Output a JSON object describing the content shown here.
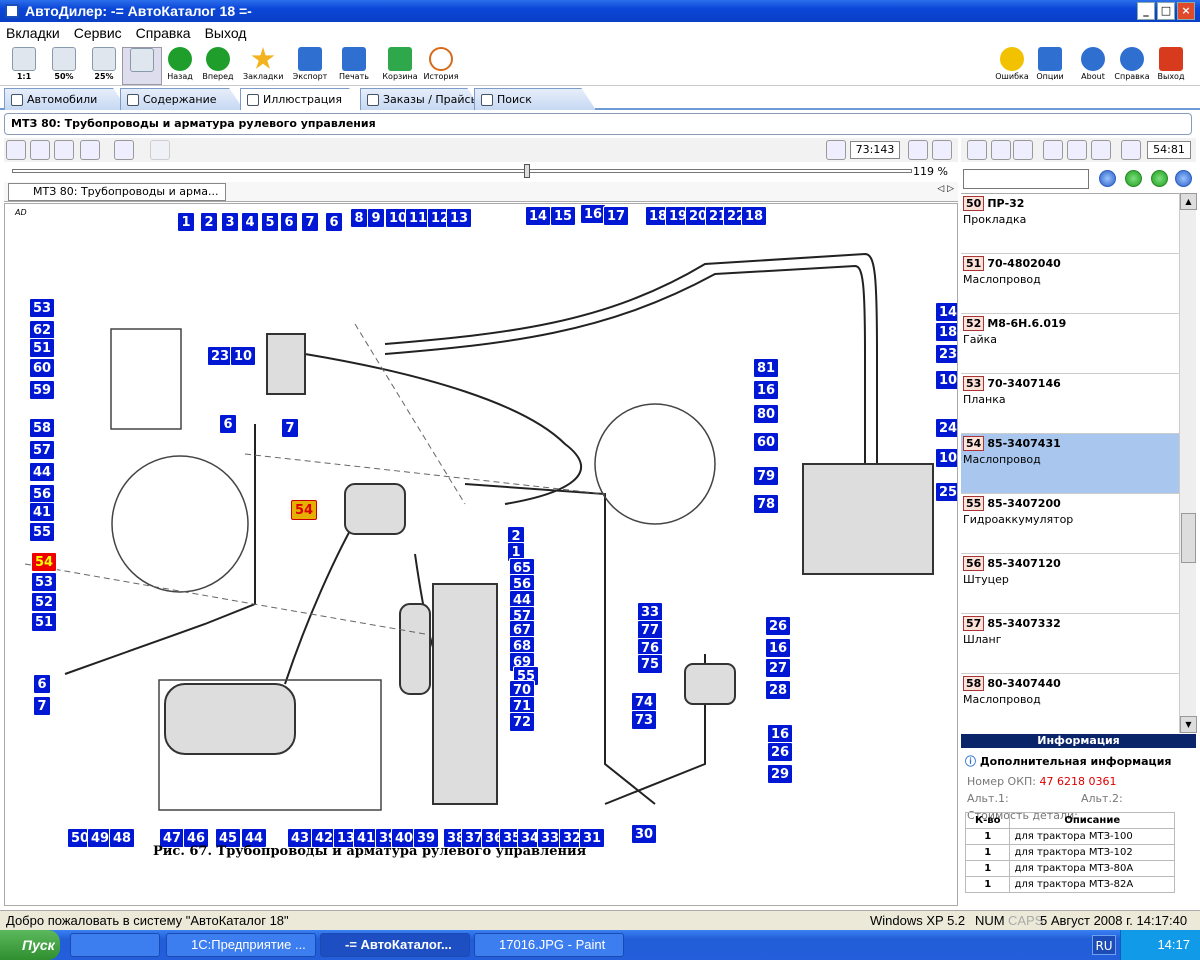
{
  "window": {
    "title": "АвтоДилер: -= АвтоКаталог 18 =-"
  },
  "menu": [
    "Вкладки",
    "Сервис",
    "Справка",
    "Выход"
  ],
  "toolbar": {
    "zoom": [
      "1:1",
      "50%",
      "25%",
      ""
    ],
    "nav": [
      {
        "label": "Назад",
        "color": "#1f9e2c"
      },
      {
        "label": "Вперед",
        "color": "#1f9e2c"
      },
      {
        "label": "Закладки",
        "color": "#f2b31e"
      },
      {
        "label": "Экспорт",
        "color": "#2e6fd0"
      },
      {
        "label": "Печать",
        "color": "#2e6fd0"
      },
      {
        "label": "Корзина",
        "color": "#2ea84a"
      },
      {
        "label": "История",
        "color": "#d66b1a"
      }
    ],
    "right": [
      {
        "label": "Ошибка",
        "color": "#f2c200"
      },
      {
        "label": "Опции",
        "color": "#2e6fd0"
      },
      {
        "label": "About",
        "color": "#2e6fd0"
      },
      {
        "label": "Справка",
        "color": "#2e6fd0"
      },
      {
        "label": "Выход",
        "color": "#d83a1e"
      }
    ]
  },
  "tabs": [
    "Автомобили",
    "Содержание",
    "Иллюстрация",
    "Заказы / Прайсы",
    "Поиск"
  ],
  "doc_title": "МТЗ 80: Трубопроводы и арматура рулевого управления",
  "page_counter": "73:143",
  "zoom_value": "119 %",
  "doc_tab": "МТЗ 80: Трубопроводы и арма...",
  "illustration": {
    "corner_mark": "AD",
    "caption": "Рис. 67. Трубопроводы и арматура рулевого управления",
    "callouts": [
      "1",
      "2",
      "3",
      "4",
      "5",
      "6",
      "7",
      "6",
      "8",
      "9",
      "10",
      "11",
      "12",
      "13",
      "14",
      "15",
      "16",
      "17",
      "18",
      "19",
      "20",
      "21",
      "22",
      "18",
      "53",
      "62",
      "51",
      "60",
      "59",
      "23",
      "10",
      "14",
      "18",
      "23",
      "10",
      "58",
      "6",
      "7",
      "81",
      "16",
      "80",
      "60",
      "57",
      "44",
      "56",
      "41",
      "55",
      "24",
      "10",
      "54",
      "79",
      "78",
      "25",
      "2",
      "1",
      "65",
      "56",
      "44",
      "57",
      "54",
      "53",
      "52",
      "51",
      "67",
      "68",
      "69",
      "33",
      "77",
      "76",
      "75",
      "26",
      "16",
      "27",
      "28",
      "6",
      "7",
      "55",
      "70",
      "71",
      "72",
      "74",
      "73",
      "16",
      "26",
      "29",
      "50",
      "49",
      "48",
      "47",
      "46",
      "45",
      "44",
      "43",
      "42",
      "13",
      "41",
      "39",
      "40",
      "39",
      "38",
      "37",
      "36",
      "35",
      "34",
      "33",
      "32",
      "31",
      "30"
    ]
  },
  "right_panel": {
    "page_counter": "54:81",
    "search": {
      "value": "",
      "placeholder": ""
    },
    "parts": [
      {
        "num": "50",
        "code": "ПР-32",
        "name": "Прокладка"
      },
      {
        "num": "51",
        "code": "70-4802040",
        "name": "Маслопровод"
      },
      {
        "num": "52",
        "code": "М8-6Н.6.019",
        "name": "Гайка"
      },
      {
        "num": "53",
        "code": "70-3407146",
        "name": "Планка"
      },
      {
        "num": "54",
        "code": "85-3407431",
        "name": "Маслопровод"
      },
      {
        "num": "55",
        "code": "85-3407200",
        "name": "Гидроаккумулятор"
      },
      {
        "num": "56",
        "code": "85-3407120",
        "name": "Штуцер"
      },
      {
        "num": "57",
        "code": "85-3407332",
        "name": "Шланг"
      },
      {
        "num": "58",
        "code": "80-3407440",
        "name": "Маслопровод"
      }
    ],
    "selected_part": "54",
    "info_header": "Информация",
    "info_title": "Дополнительная информация",
    "okp_label": "Номер ОКП:",
    "okp_value": "47 6218 0361",
    "alt1": "Альт.1:",
    "alt2": "Альт.2:",
    "cost": "Стоимость детали:",
    "table_headers": [
      "К-во",
      "Описание"
    ],
    "table_rows": [
      {
        "qty": "1",
        "desc": "для трактора МТЗ-100"
      },
      {
        "qty": "1",
        "desc": "для трактора МТЗ-102"
      },
      {
        "qty": "1",
        "desc": "для трактора МТЗ-80А"
      },
      {
        "qty": "1",
        "desc": "для трактора МТЗ-82А"
      }
    ]
  },
  "status": {
    "message": "Добро пожаловать в систему \"АвтоКаталог 18\"",
    "os": "Windows XP 5.2",
    "num": "NUM",
    "caps": "CAPS",
    "datetime": "5 Август 2008 г. 14:17:40"
  },
  "taskbar": {
    "start": "Пуск",
    "tasks": [
      "1С:Предприятие ...",
      "-= АвтоКаталог...",
      "17016.JPG - Paint"
    ],
    "lang": "RU",
    "clock": "14:17"
  }
}
